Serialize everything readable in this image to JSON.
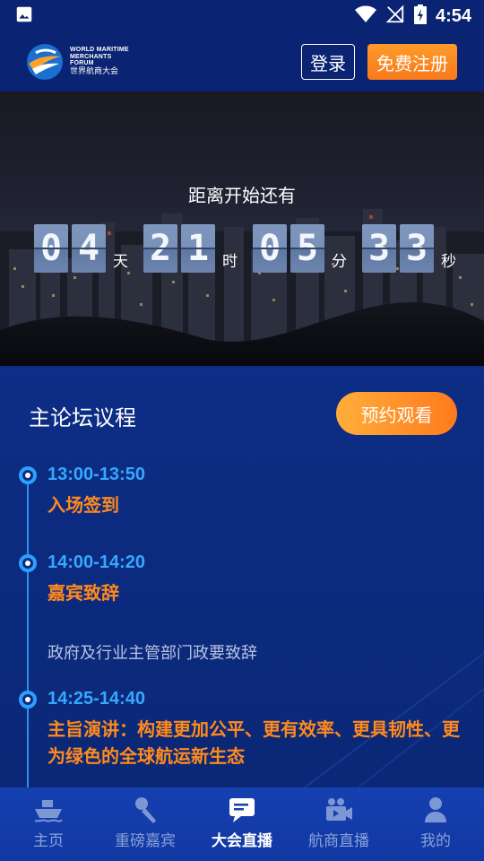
{
  "status_bar": {
    "time": "4:54"
  },
  "header": {
    "logo_en": "WORLD MARITIME MERCHANTS FORUM",
    "logo_cn": "世界航商大会",
    "login_label": "登录",
    "register_label": "免费注册"
  },
  "hero": {
    "title": "距离开始还有",
    "countdown": {
      "days": [
        "0",
        "4"
      ],
      "hours": [
        "2",
        "1"
      ],
      "minutes": [
        "0",
        "5"
      ],
      "seconds": [
        "3",
        "3"
      ],
      "unit_day": "天",
      "unit_hour": "时",
      "unit_minute": "分",
      "unit_second": "秒"
    }
  },
  "agenda": {
    "title": "主论坛议程",
    "reserve_label": "预约观看",
    "items": [
      {
        "time": "13:00-13:50",
        "title": "入场签到",
        "desc": ""
      },
      {
        "time": "14:00-14:20",
        "title": "嘉宾致辞",
        "desc": "政府及行业主管部门政要致辞"
      },
      {
        "time": "14:25-14:40",
        "title": "主旨演讲：构建更加公平、更有效率、更具韧性、更为绿色的全球航运新生态",
        "desc": ""
      }
    ]
  },
  "bottom_nav": {
    "items": [
      {
        "label": "主页",
        "icon": "ship-icon",
        "active": false
      },
      {
        "label": "重磅嘉宾",
        "icon": "microphone-icon",
        "active": false
      },
      {
        "label": "大会直播",
        "icon": "chat-icon",
        "active": true
      },
      {
        "label": "航商直播",
        "icon": "video-camera-icon",
        "active": false
      },
      {
        "label": "我的",
        "icon": "user-icon",
        "active": false
      }
    ]
  },
  "colors": {
    "background": "#0b2573",
    "accent_orange": "#ff8a1e",
    "accent_blue": "#35a8ff",
    "nav_inactive": "#8aa2d8"
  }
}
